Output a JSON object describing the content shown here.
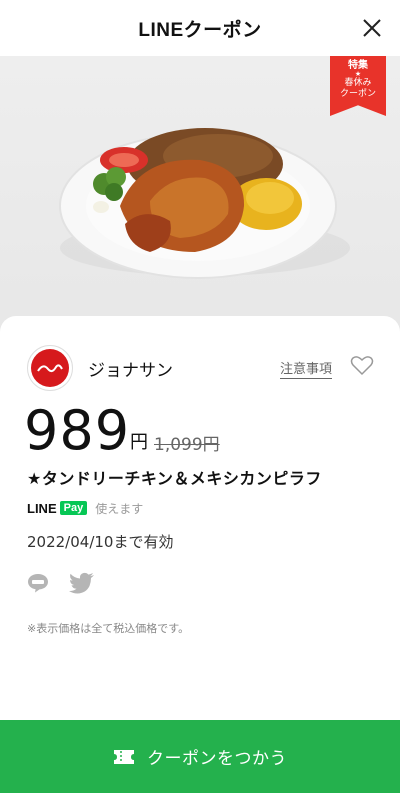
{
  "header": {
    "title": "LINEクーポン"
  },
  "banner": {
    "line1": "特集",
    "star": "★",
    "line2": "春休み",
    "line3": "クーポン"
  },
  "coupon": {
    "brand": "ジョナサン",
    "notice": "注意事項",
    "price": "989",
    "unit": "円",
    "original_price": "1,099円",
    "product": "★タンドリーチキン＆メキシカンピラフ",
    "linepay_line": "LINE",
    "linepay_pay": "Pay",
    "linepay_text": "使えます",
    "expiry": "2022/04/10まで有効",
    "note": "※表示価格は全て税込価格です。"
  },
  "cta": {
    "label": "クーポンをつかう"
  },
  "colors": {
    "accent": "#24b14d",
    "ribbon": "#e8332a",
    "linepay": "#06c755",
    "brand": "#d6191c"
  }
}
